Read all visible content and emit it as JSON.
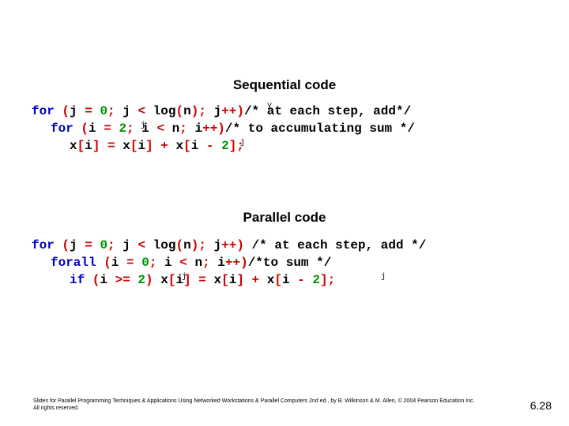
{
  "headings": {
    "sequential": "Sequential code",
    "parallel": "Parallel code"
  },
  "sequential_code": {
    "l1": {
      "kw_for": "for",
      "p1": " (",
      "v_j1": "j",
      "eq1": " = ",
      "n0": "0",
      "sc1": "; ",
      "v_j2": "j",
      "lt": " < ",
      "fn_log": "log",
      "p2": "(",
      "v_n": "n",
      "p3": ")",
      "sc2": "; ",
      "v_j3": "j",
      "pp": "++",
      "p4": ")",
      "cm": "/* at each step, add*/"
    },
    "l2": {
      "kw_for": "for",
      "p1": " (",
      "v_i1": "i",
      "eq1": " = ",
      "n2": "2",
      "sc1": "; ",
      "v_i2": "i",
      "lt": " < ",
      "v_n": "n",
      "sc2": "; ",
      "v_i3": "i",
      "pp": "++",
      "p2": ")",
      "cm": "/* to accumulating sum */"
    },
    "l3": {
      "v_x1": "x",
      "br1": "[",
      "v_i1": "i",
      "br2": "]",
      "eq": " = ",
      "v_x2": "x",
      "br3": "[",
      "v_i2": "i",
      "br4": "]",
      "plus": " + ",
      "v_x3": "x",
      "br5": "[",
      "v_i3": "i",
      "minus": " - ",
      "n2": "2",
      "br6": "]",
      "sc": ";"
    }
  },
  "parallel_code": {
    "l1": {
      "kw_for": "for",
      "p1": " (",
      "v_j1": "j",
      "eq1": " = ",
      "n0": "0",
      "sc1": "; ",
      "v_j2": "j",
      "lt": " < ",
      "fn_log": "log",
      "p2": "(",
      "v_n": "n",
      "p3": ")",
      "sc2": "; ",
      "v_j3": "j",
      "pp": "++",
      "p4": ") ",
      "cm": "/* at each step, add */"
    },
    "l2": {
      "kw_forall": "forall",
      "p1": " (",
      "v_i1": "i",
      "eq1": " = ",
      "n0": "0",
      "sc1": "; ",
      "v_i2": "i",
      "lt": " < ",
      "v_n": "n",
      "sc2": "; ",
      "v_i3": "i",
      "pp": "++",
      "p2": ")",
      "cm": "/*to sum */"
    },
    "l3": {
      "kw_if": "if",
      "p1": " (",
      "v_i1": "i",
      "ge": " >= ",
      "n2a": "2",
      "p2": ") ",
      "v_x1": "x",
      "br1": "[",
      "v_i2": "i",
      "br2": "]",
      "eq": " = ",
      "v_x2": "x",
      "br3": "[",
      "v_i3": "i",
      "br4": "]",
      "plus": " + ",
      "v_x3": "x",
      "br5": "[",
      "v_i4": "i",
      "minus": " - ",
      "n2b": "2",
      "br6": "]",
      "sc": ";"
    }
  },
  "overlays": {
    "sq_y": "y",
    "sq_j1": "j",
    "sq_j2": "j",
    "pa_j1": "j",
    "pa_j2": "j"
  },
  "footer": "Slides for Parallel Programming Techniques & Applications Using Networked Workstations & Parallel Computers 2nd ed., by B. Wilkinson & M. Allen, © 2004 Pearson Education Inc. All rights reserved.",
  "page_number": "6.28"
}
